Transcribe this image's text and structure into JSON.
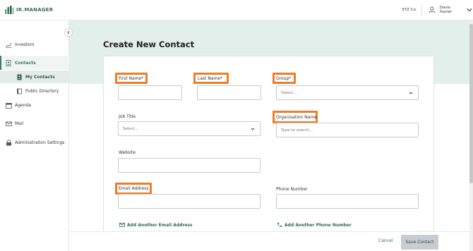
{
  "app": {
    "logo_text": "IR.MANAGER"
  },
  "header": {
    "company": "XYZ Co.",
    "user_name": "Davis Xavier"
  },
  "sidebar": {
    "items": [
      {
        "label": "Investors",
        "icon": "chart-icon"
      },
      {
        "label": "Contacts",
        "icon": "contacts-icon"
      },
      {
        "label": "My Contacts",
        "icon": "person-card-icon"
      },
      {
        "label": "Public Directory",
        "icon": "book-icon"
      },
      {
        "label": "Agenda",
        "icon": "calendar-icon"
      },
      {
        "label": "Mail",
        "icon": "mail-icon"
      },
      {
        "label": "Administration Settings",
        "icon": "lock-icon"
      }
    ]
  },
  "page": {
    "title": "Create New Contact"
  },
  "form": {
    "first_name": {
      "label": "First Name*",
      "value": ""
    },
    "last_name": {
      "label": "Last Name*",
      "value": ""
    },
    "group": {
      "label": "Group*",
      "placeholder": "Select..."
    },
    "job_title": {
      "label": "Job Title",
      "placeholder": "Select..."
    },
    "organisation": {
      "label": "Organisation Name",
      "placeholder": "Type to search..."
    },
    "website": {
      "label": "Website",
      "value": ""
    },
    "email": {
      "label": "Email Address",
      "value": ""
    },
    "phone": {
      "label": "Phone Number",
      "value": ""
    },
    "add_email": "Add Another Email Address",
    "add_phone": "Add Another Phone Number"
  },
  "footer": {
    "cancel": "Cancel",
    "save": "Save Contact"
  },
  "colors": {
    "accent": "#3e7a68",
    "highlight": "#f07c28",
    "hero": "#e3efeb"
  }
}
